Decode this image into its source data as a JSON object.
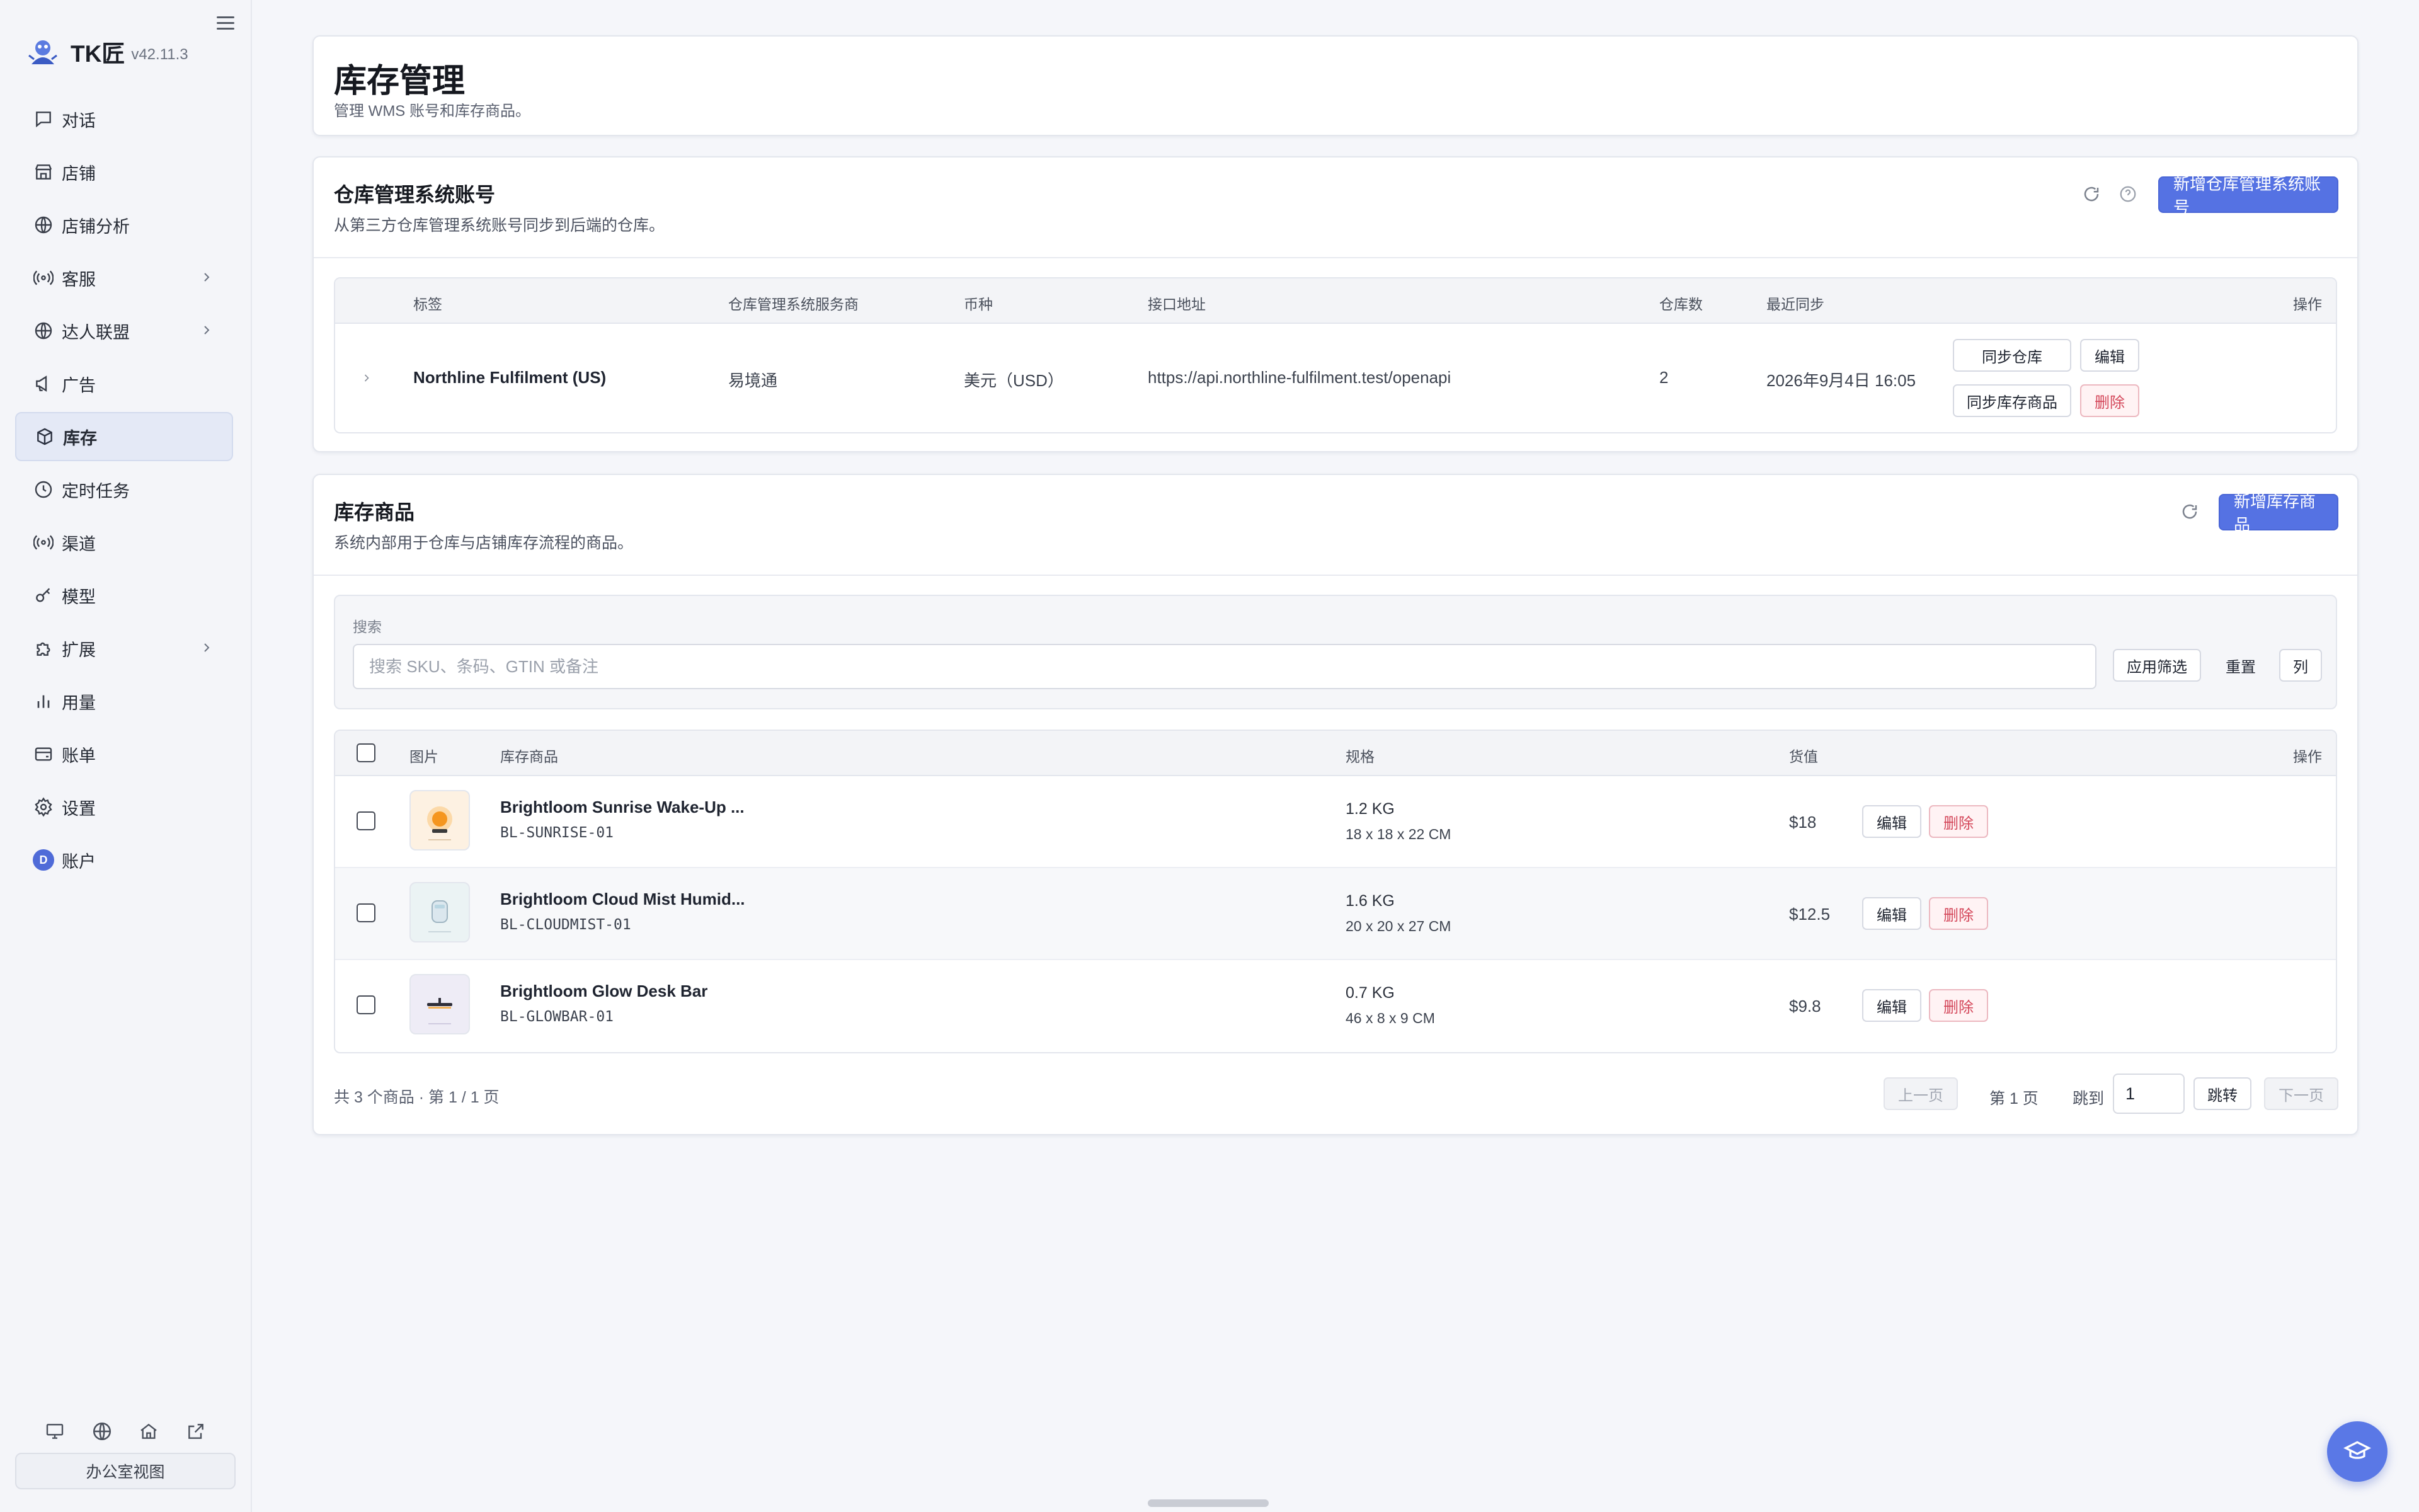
{
  "app": {
    "name": "TK匠",
    "version": "v42.11.3"
  },
  "sidebar": {
    "items": [
      {
        "label": "对话",
        "icon": "chat-icon"
      },
      {
        "label": "店铺",
        "icon": "store-icon"
      },
      {
        "label": "店铺分析",
        "icon": "globe-icon"
      },
      {
        "label": "客服",
        "icon": "broadcast-icon",
        "expandable": true
      },
      {
        "label": "达人联盟",
        "icon": "globe-icon",
        "expandable": true
      },
      {
        "label": "广告",
        "icon": "megaphone-icon"
      },
      {
        "label": "库存",
        "icon": "box-icon",
        "active": true
      },
      {
        "label": "定时任务",
        "icon": "clock-icon"
      },
      {
        "label": "渠道",
        "icon": "broadcast-icon"
      },
      {
        "label": "模型",
        "icon": "key-icon"
      },
      {
        "label": "扩展",
        "icon": "puzzle-icon",
        "expandable": true
      },
      {
        "label": "用量",
        "icon": "bar-chart-icon"
      },
      {
        "label": "账单",
        "icon": "wallet-icon"
      },
      {
        "label": "设置",
        "icon": "gear-icon"
      },
      {
        "label": "账户",
        "icon": "avatar",
        "avatar_letter": "D"
      }
    ],
    "bottom_icons": [
      "monitor-icon",
      "globe-icon",
      "home-icon",
      "external-link-icon"
    ],
    "office_view_label": "办公室视图"
  },
  "header": {
    "title": "库存管理",
    "subtitle": "管理 WMS 账号和库存商品。"
  },
  "wms_section": {
    "title": "仓库管理系统账号",
    "subtitle": "从第三方仓库管理系统账号同步到后端的仓库。",
    "add_button": "新增仓库管理系统账号",
    "columns": {
      "label": "标签",
      "provider": "仓库管理系统服务商",
      "currency": "币种",
      "endpoint": "接口地址",
      "warehouses": "仓库数",
      "last_sync": "最近同步",
      "actions": "操作"
    },
    "rows": [
      {
        "label": "Northline Fulfilment (US)",
        "provider": "易境通",
        "currency": "美元（USD）",
        "endpoint": "https://api.northline-fulfilment.test/openapi",
        "warehouses": "2",
        "last_sync": "2026年9月4日 16:05",
        "actions": {
          "sync_warehouse": "同步仓库",
          "edit": "编辑",
          "sync_inventory": "同步库存商品",
          "delete": "删除"
        }
      }
    ]
  },
  "inventory_section": {
    "title": "库存商品",
    "subtitle": "系统内部用于仓库与店铺库存流程的商品。",
    "add_button": "新增库存商品",
    "filter": {
      "label": "搜索",
      "placeholder": "搜索 SKU、条码、GTIN 或备注",
      "value": "",
      "apply_button": "应用筛选",
      "reset_button": "重置",
      "columns_button": "列"
    },
    "columns": {
      "image": "图片",
      "product": "库存商品",
      "spec": "规格",
      "value": "货值",
      "actions": "操作"
    },
    "rows": [
      {
        "name": "Brightloom Sunrise Wake-Up ...",
        "sku": "BL-SUNRISE-01",
        "weight": "1.2 KG",
        "dims": "18 x 18 x 22 CM",
        "value": "$18",
        "edit": "编辑",
        "delete": "删除",
        "thumb_color": "#f7a53a"
      },
      {
        "name": "Brightloom Cloud Mist Humid...",
        "sku": "BL-CLOUDMIST-01",
        "weight": "1.6 KG",
        "dims": "20 x 20 x 27 CM",
        "value": "$12.5",
        "edit": "编辑",
        "delete": "删除",
        "thumb_color": "#b9d6e2"
      },
      {
        "name": "Brightloom Glow Desk Bar",
        "sku": "BL-GLOWBAR-01",
        "weight": "0.7 KG",
        "dims": "46 x 8 x 9 CM",
        "value": "$9.8",
        "edit": "编辑",
        "delete": "删除",
        "thumb_color": "#2f2f3a"
      }
    ],
    "pagination": {
      "summary": "共 3 个商品 · 第 1 / 1 页",
      "prev": "上一页",
      "current": "第 1 页",
      "jump_label": "跳到",
      "jump_value": "1",
      "jump_button": "跳转",
      "next": "下一页"
    }
  },
  "colors": {
    "accent": "#5572e3",
    "danger": "#d4475a",
    "active_nav": "#e4e9f6"
  }
}
